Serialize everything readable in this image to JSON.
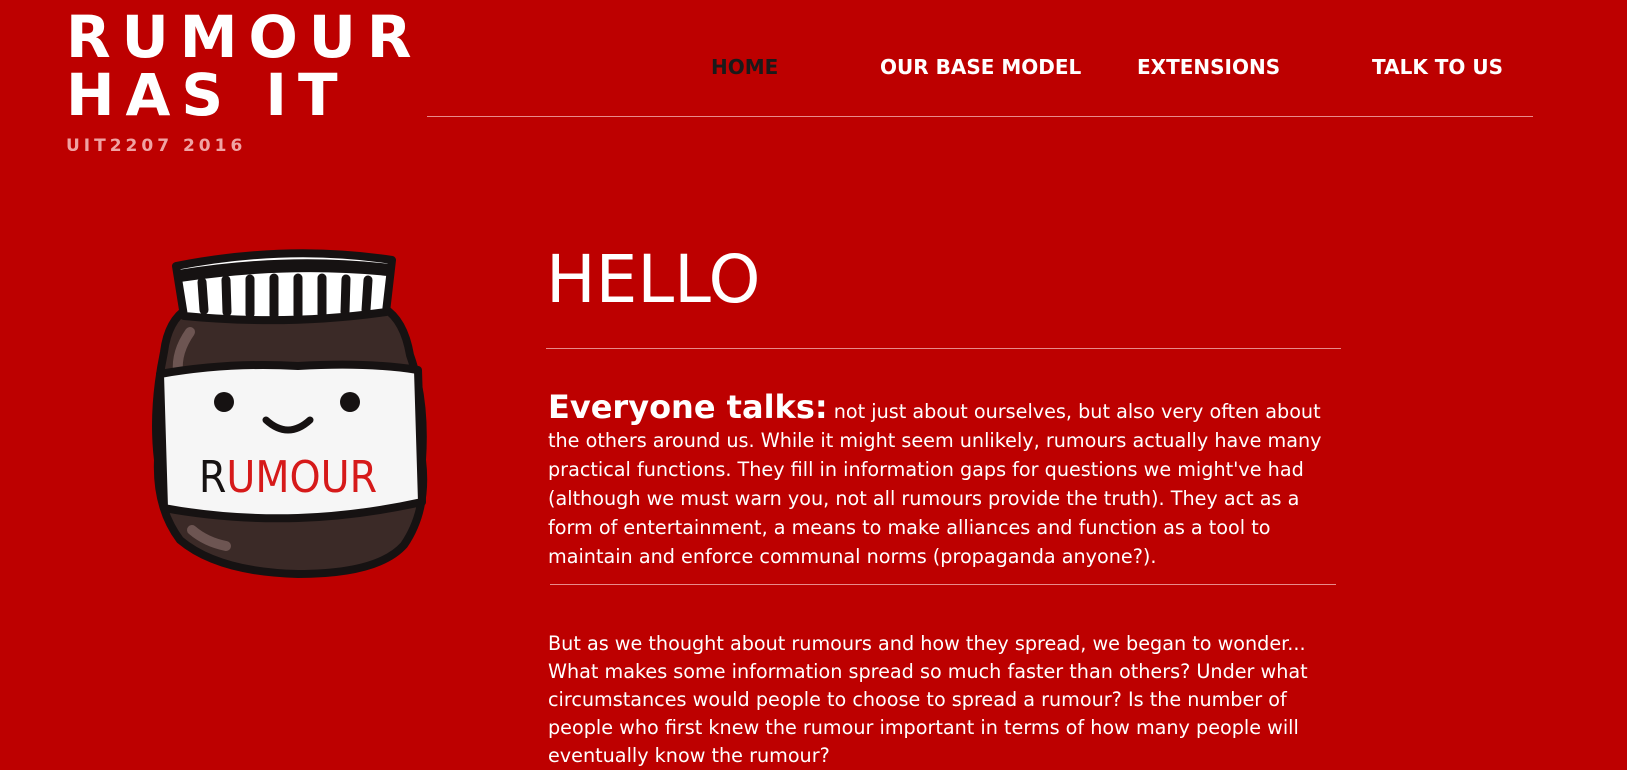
{
  "site": {
    "title_line1": "RUMOUR",
    "title_line2": "HAS IT",
    "subtitle": "UIT2207 2016"
  },
  "nav": {
    "items": [
      {
        "label": "HOME",
        "active": true
      },
      {
        "label": "OUR BASE MODEL",
        "active": false
      },
      {
        "label": "EXTENSIONS",
        "active": false
      },
      {
        "label": "TALK TO US",
        "active": false
      }
    ]
  },
  "hero": {
    "jar_label_first_letter": "R",
    "jar_label_rest": "UMOUR",
    "icon": "rumour-jar-illustration"
  },
  "main": {
    "heading": "HELLO",
    "paragraph1_lead": "Everyone talks:",
    "paragraph1_body": " not just about ourselves, but also very often about the others around us. While it might seem unlikely, rumours actually have many practical functions. They fill in information gaps for questions we might've had (although we must warn you, not all rumours provide the truth). They act as a form of entertainment, a means to make alliances and function as a tool to maintain and enforce communal norms (propaganda anyone?).",
    "paragraph2": "But as we thought about rumours and how they spread, we began to wonder... What makes some information spread so much faster than others? Under what circumstances would people to choose to spread a rumour? Is the number of people who first knew the rumour important in terms of how many people will eventually know the rumour?"
  },
  "colors": {
    "background": "#bd0000",
    "text": "#ffffff",
    "nav_active": "#1a1a1a",
    "subtitle": "#f0a3a3",
    "divider": "#e88a8a"
  }
}
